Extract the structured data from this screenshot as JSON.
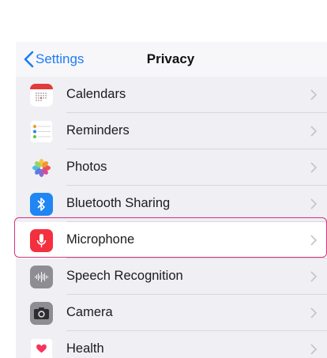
{
  "nav": {
    "back_label": "Settings",
    "title": "Privacy"
  },
  "rows": [
    {
      "label": "Calendars",
      "icon": "calendar-icon"
    },
    {
      "label": "Reminders",
      "icon": "reminders-icon"
    },
    {
      "label": "Photos",
      "icon": "photos-icon"
    },
    {
      "label": "Bluetooth Sharing",
      "icon": "bluetooth-icon"
    },
    {
      "label": "Microphone",
      "icon": "microphone-icon",
      "selected": true
    },
    {
      "label": "Speech Recognition",
      "icon": "speech-recognition-icon"
    },
    {
      "label": "Camera",
      "icon": "camera-icon"
    },
    {
      "label": "Health",
      "icon": "health-icon"
    }
  ],
  "colors": {
    "accent": "#1e7bf5",
    "highlight": "#d4327f",
    "microphone": "#f4303e",
    "bluetooth": "#1f86f4"
  }
}
